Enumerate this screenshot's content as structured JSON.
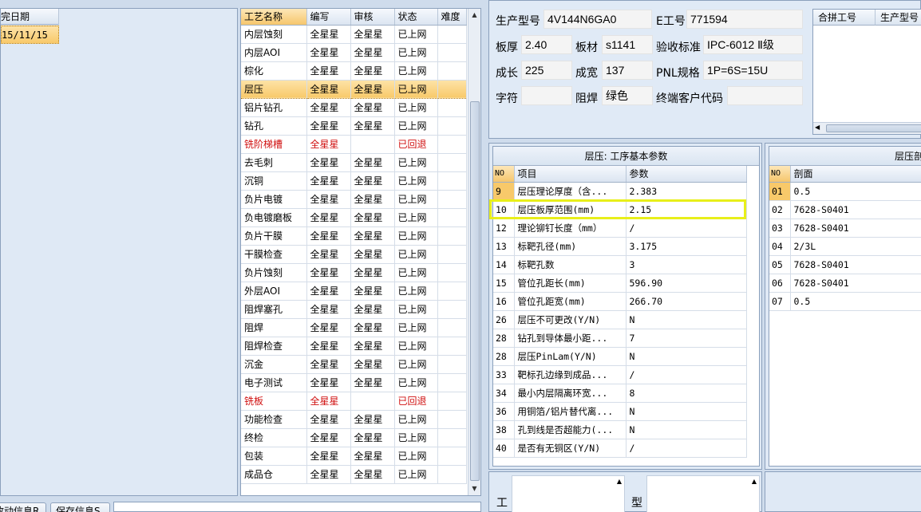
{
  "left_list": {
    "header": "完日期",
    "rows": [
      "15/11/15"
    ]
  },
  "process_table": {
    "headers": [
      "工艺名称",
      "编写",
      "审核",
      "状态",
      "难度"
    ],
    "rows": [
      {
        "name": "内层蚀刻",
        "writer": "全星星",
        "reviewer": "全星星",
        "status": "已上网",
        "difficulty": "",
        "red": false
      },
      {
        "name": "内层AOI",
        "writer": "全星星",
        "reviewer": "全星星",
        "status": "已上网",
        "difficulty": "",
        "red": false
      },
      {
        "name": "棕化",
        "writer": "全星星",
        "reviewer": "全星星",
        "status": "已上网",
        "difficulty": "",
        "red": false
      },
      {
        "name": "层压",
        "writer": "全星星",
        "reviewer": "全星星",
        "status": "已上网",
        "difficulty": "",
        "red": false,
        "selected": true
      },
      {
        "name": "铝片钻孔",
        "writer": "全星星",
        "reviewer": "全星星",
        "status": "已上网",
        "difficulty": "",
        "red": false
      },
      {
        "name": "钻孔",
        "writer": "全星星",
        "reviewer": "全星星",
        "status": "已上网",
        "difficulty": "",
        "red": false
      },
      {
        "name": "铣阶梯槽",
        "writer": "全星星",
        "reviewer": "",
        "status": "已回退",
        "difficulty": "",
        "red": true
      },
      {
        "name": "去毛刺",
        "writer": "全星星",
        "reviewer": "全星星",
        "status": "已上网",
        "difficulty": "",
        "red": false
      },
      {
        "name": "沉铜",
        "writer": "全星星",
        "reviewer": "全星星",
        "status": "已上网",
        "difficulty": "",
        "red": false
      },
      {
        "name": "负片电镀",
        "writer": "全星星",
        "reviewer": "全星星",
        "status": "已上网",
        "difficulty": "",
        "red": false
      },
      {
        "name": "负电镀磨板",
        "writer": "全星星",
        "reviewer": "全星星",
        "status": "已上网",
        "difficulty": "",
        "red": false
      },
      {
        "name": "负片干膜",
        "writer": "全星星",
        "reviewer": "全星星",
        "status": "已上网",
        "difficulty": "",
        "red": false
      },
      {
        "name": "干膜检查",
        "writer": "全星星",
        "reviewer": "全星星",
        "status": "已上网",
        "difficulty": "",
        "red": false
      },
      {
        "name": "负片蚀刻",
        "writer": "全星星",
        "reviewer": "全星星",
        "status": "已上网",
        "difficulty": "",
        "red": false
      },
      {
        "name": "外层AOI",
        "writer": "全星星",
        "reviewer": "全星星",
        "status": "已上网",
        "difficulty": "",
        "red": false
      },
      {
        "name": "阻焊塞孔",
        "writer": "全星星",
        "reviewer": "全星星",
        "status": "已上网",
        "difficulty": "",
        "red": false
      },
      {
        "name": "阻焊",
        "writer": "全星星",
        "reviewer": "全星星",
        "status": "已上网",
        "difficulty": "",
        "red": false
      },
      {
        "name": "阻焊检查",
        "writer": "全星星",
        "reviewer": "全星星",
        "status": "已上网",
        "difficulty": "",
        "red": false
      },
      {
        "name": "沉金",
        "writer": "全星星",
        "reviewer": "全星星",
        "status": "已上网",
        "difficulty": "",
        "red": false
      },
      {
        "name": "电子测试",
        "writer": "全星星",
        "reviewer": "全星星",
        "status": "已上网",
        "difficulty": "",
        "red": false
      },
      {
        "name": "铣板",
        "writer": "全星星",
        "reviewer": "",
        "status": "已回退",
        "difficulty": "",
        "red": true
      },
      {
        "name": "功能检查",
        "writer": "全星星",
        "reviewer": "全星星",
        "status": "已上网",
        "difficulty": "",
        "red": false
      },
      {
        "name": "终检",
        "writer": "全星星",
        "reviewer": "全星星",
        "status": "已上网",
        "difficulty": "",
        "red": false
      },
      {
        "name": "包装",
        "writer": "全星星",
        "reviewer": "全星星",
        "status": "已上网",
        "difficulty": "",
        "red": false
      },
      {
        "name": "成品仓",
        "writer": "全星星",
        "reviewer": "全星星",
        "status": "已上网",
        "difficulty": "",
        "red": false
      }
    ]
  },
  "info": {
    "model_label": "生产型号",
    "model_value": "4V144N6GA0",
    "eno_label": "E工号",
    "eno_value": "771594",
    "thickness_label": "板厚",
    "thickness_value": "2.40",
    "material_label": "板材",
    "material_value": "s1141",
    "standard_label": "验收标准",
    "standard_value": "IPC-6012 Ⅱ级",
    "length_label": "成长",
    "length_value": "225",
    "width_label": "成宽",
    "width_value": "137",
    "pnl_label": "PNL规格",
    "pnl_value": "1P=6S=15U",
    "char_label": "字符",
    "char_value": "",
    "solder_label": "阻焊",
    "solder_value": "绿色",
    "customer_label": "终端客户代码",
    "customer_value": ""
  },
  "merge_table": {
    "headers": [
      "合拼工号",
      "生产型号"
    ]
  },
  "params": {
    "title": "层压: 工序基本参数",
    "headers": [
      "NO",
      "项目",
      "参数"
    ],
    "rows": [
      {
        "no": "9",
        "item": "层压理论厚度（含...",
        "value": "2.383",
        "selected": true
      },
      {
        "no": "10",
        "item": "层压板厚范围(mm)",
        "value": "2.15",
        "highlight": true
      },
      {
        "no": "12",
        "item": "理论铆钉长度（mm）",
        "value": "/"
      },
      {
        "no": "13",
        "item": "标靶孔径(mm)",
        "value": "3.175"
      },
      {
        "no": "14",
        "item": "标靶孔数",
        "value": "3"
      },
      {
        "no": "15",
        "item": "管位孔距长(mm)",
        "value": "596.90"
      },
      {
        "no": "16",
        "item": "管位孔距宽(mm)",
        "value": "266.70"
      },
      {
        "no": "26",
        "item": "层压不可更改(Y/N)",
        "value": "N"
      },
      {
        "no": "28",
        "item": "钻孔到导体最小距...",
        "value": "7"
      },
      {
        "no": "28",
        "item": "层压PinLam(Y/N)",
        "value": "N"
      },
      {
        "no": "33",
        "item": "靶标孔边缘到成品...",
        "value": "/"
      },
      {
        "no": "34",
        "item": "最小内层隔离环宽...",
        "value": "8"
      },
      {
        "no": "36",
        "item": "用铜箔/铝片替代离...",
        "value": "N"
      },
      {
        "no": "38",
        "item": "孔到线是否超能力(...",
        "value": "N"
      },
      {
        "no": "40",
        "item": "是否有无铜区(Y/N)",
        "value": "/"
      }
    ]
  },
  "stack": {
    "title": "层压剖",
    "headers": [
      "NO",
      "剖面"
    ],
    "rows": [
      {
        "no": "01",
        "value": "0.5",
        "selected": true
      },
      {
        "no": "02",
        "value": "7628-S0401"
      },
      {
        "no": "03",
        "value": "7628-S0401"
      },
      {
        "no": "04",
        "value": "2/3L"
      },
      {
        "no": "05",
        "value": "7628-S0401"
      },
      {
        "no": "06",
        "value": "7628-S0401"
      },
      {
        "no": "07",
        "value": "0.5"
      }
    ]
  },
  "bottom": {
    "btn1": "改动信息R",
    "btn2": "保存信息S",
    "label_left": "工",
    "label_right": "型"
  }
}
